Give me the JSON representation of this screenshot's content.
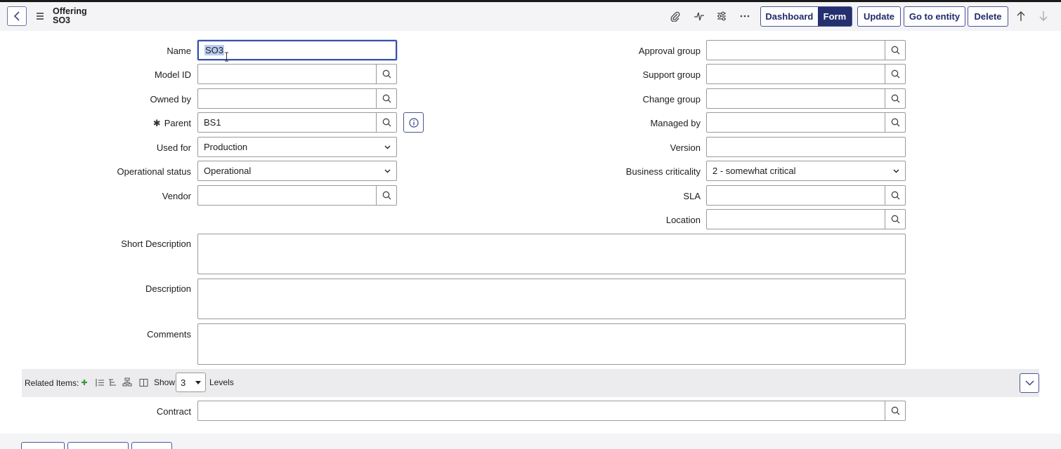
{
  "header": {
    "title_line1": "Offering",
    "title_line2": "SO3",
    "icons": [
      "back-icon",
      "hamburger-icon",
      "paperclip-icon",
      "activity-icon",
      "settings-sliders-icon",
      "more-icon",
      "arrow-up-icon",
      "arrow-down-icon"
    ],
    "view_toggle": {
      "dashboard": "Dashboard",
      "form": "Form",
      "active": "Form"
    },
    "buttons": {
      "update": "Update",
      "go_to_entity": "Go to entity",
      "delete": "Delete"
    }
  },
  "form": {
    "left": {
      "name": {
        "label": "Name",
        "value": "SO3"
      },
      "model_id": {
        "label": "Model ID",
        "value": ""
      },
      "owned_by": {
        "label": "Owned by",
        "value": ""
      },
      "parent": {
        "label": "Parent",
        "required_mark": "✱",
        "value": "BS1"
      },
      "used_for": {
        "label": "Used for",
        "value": "Production"
      },
      "operational_status": {
        "label": "Operational status",
        "value": "Operational"
      },
      "vendor": {
        "label": "Vendor",
        "value": ""
      }
    },
    "right": {
      "approval_group": {
        "label": "Approval group",
        "value": ""
      },
      "support_group": {
        "label": "Support group",
        "value": ""
      },
      "change_group": {
        "label": "Change group",
        "value": ""
      },
      "managed_by": {
        "label": "Managed by",
        "value": ""
      },
      "version": {
        "label": "Version",
        "value": ""
      },
      "business_criticality": {
        "label": "Business criticality",
        "value": "2 - somewhat critical"
      },
      "sla": {
        "label": "SLA",
        "value": ""
      },
      "location": {
        "label": "Location",
        "value": ""
      }
    },
    "short_description": {
      "label": "Short Description",
      "value": ""
    },
    "description": {
      "label": "Description",
      "value": ""
    },
    "comments": {
      "label": "Comments",
      "value": ""
    }
  },
  "related": {
    "label": "Related Items:",
    "show_label": "Show",
    "levels_value": "3",
    "levels_label": "Levels"
  },
  "contract": {
    "label": "Contract",
    "value": ""
  },
  "colors": {
    "accent": "#24306e",
    "border": "#4a5596",
    "focus": "#3550a8",
    "add_green": "#3a9a3a"
  }
}
